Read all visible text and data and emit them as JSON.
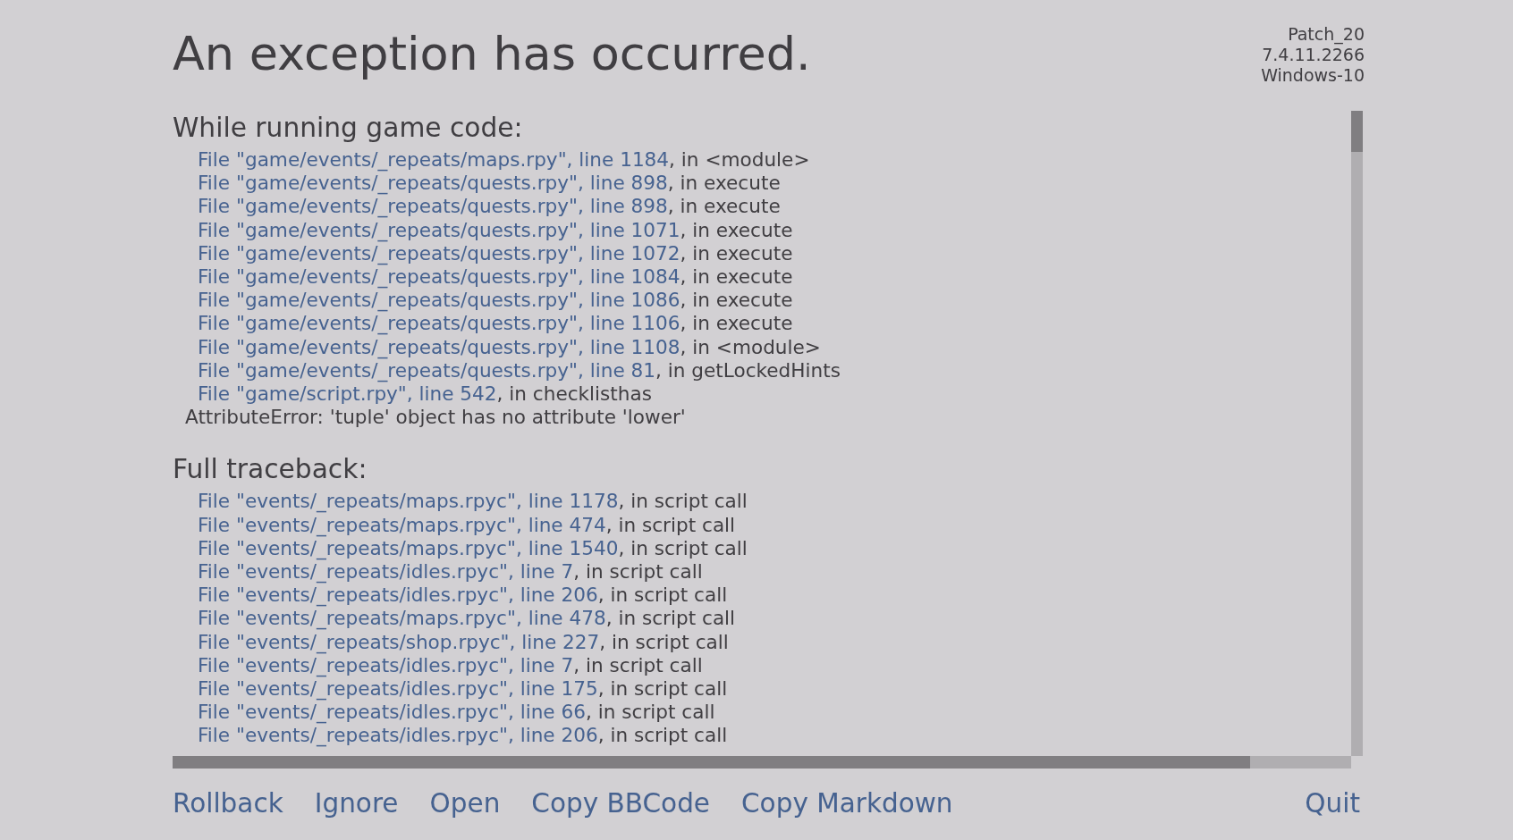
{
  "title": "An exception has occurred.",
  "build_info": [
    "Patch_20",
    "7.4.11.2266",
    "Windows-10"
  ],
  "sections": [
    {
      "heading": "While running game code:",
      "frames": [
        {
          "location": "File \"game/events/_repeats/maps.rpy\", line 1184",
          "context": ", in <module>"
        },
        {
          "location": "File \"game/events/_repeats/quests.rpy\", line 898",
          "context": ", in execute"
        },
        {
          "location": "File \"game/events/_repeats/quests.rpy\", line 898",
          "context": ", in execute"
        },
        {
          "location": "File \"game/events/_repeats/quests.rpy\", line 1071",
          "context": ", in execute"
        },
        {
          "location": "File \"game/events/_repeats/quests.rpy\", line 1072",
          "context": ", in execute"
        },
        {
          "location": "File \"game/events/_repeats/quests.rpy\", line 1084",
          "context": ", in execute"
        },
        {
          "location": "File \"game/events/_repeats/quests.rpy\", line 1086",
          "context": ", in execute"
        },
        {
          "location": "File \"game/events/_repeats/quests.rpy\", line 1106",
          "context": ", in execute"
        },
        {
          "location": "File \"game/events/_repeats/quests.rpy\", line 1108",
          "context": ", in <module>"
        },
        {
          "location": "File \"game/events/_repeats/quests.rpy\", line 81",
          "context": ", in getLockedHints"
        },
        {
          "location": "File \"game/script.rpy\", line 542",
          "context": ", in checklisthas"
        }
      ],
      "error": "AttributeError: 'tuple' object has no attribute 'lower'"
    },
    {
      "heading": "Full traceback:",
      "frames": [
        {
          "location": "File \"events/_repeats/maps.rpyc\", line 1178",
          "context": ", in script call"
        },
        {
          "location": "File \"events/_repeats/maps.rpyc\", line 474",
          "context": ", in script call"
        },
        {
          "location": "File \"events/_repeats/maps.rpyc\", line 1540",
          "context": ", in script call"
        },
        {
          "location": "File \"events/_repeats/idles.rpyc\", line 7",
          "context": ", in script call"
        },
        {
          "location": "File \"events/_repeats/idles.rpyc\", line 206",
          "context": ", in script call"
        },
        {
          "location": "File \"events/_repeats/maps.rpyc\", line 478",
          "context": ", in script call"
        },
        {
          "location": "File \"events/_repeats/shop.rpyc\", line 227",
          "context": ", in script call"
        },
        {
          "location": "File \"events/_repeats/idles.rpyc\", line 7",
          "context": ", in script call"
        },
        {
          "location": "File \"events/_repeats/idles.rpyc\", line 175",
          "context": ", in script call"
        },
        {
          "location": "File \"events/_repeats/idles.rpyc\", line 66",
          "context": ", in script call"
        },
        {
          "location": "File \"events/_repeats/idles.rpyc\", line 206",
          "context": ", in script call"
        }
      ]
    }
  ],
  "actions": [
    "Rollback",
    "Ignore",
    "Open",
    "Copy BBCode",
    "Copy Markdown"
  ],
  "quit": "Quit"
}
